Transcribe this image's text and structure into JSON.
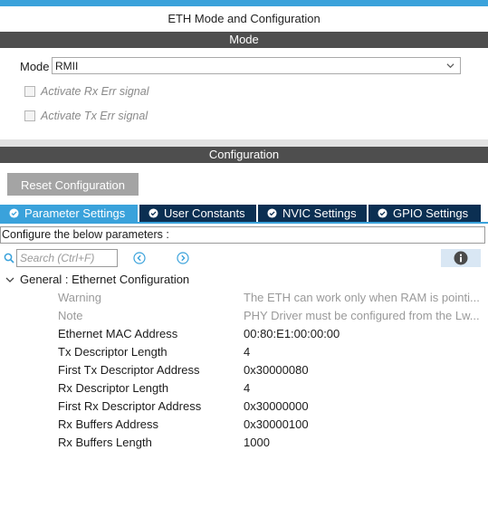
{
  "window": {
    "title": "ETH Mode and Configuration"
  },
  "mode_section": {
    "header": "Mode",
    "mode_label": "Mode",
    "mode_value": "RMII",
    "checkboxes": [
      {
        "label": "Activate Rx Err signal",
        "checked": false
      },
      {
        "label": "Activate Tx Err signal",
        "checked": false
      }
    ]
  },
  "config_section": {
    "header": "Configuration",
    "reset_label": "Reset Configuration",
    "tabs": [
      {
        "label": "Parameter Settings",
        "active": true
      },
      {
        "label": "User Constants",
        "active": false
      },
      {
        "label": "NVIC Settings",
        "active": false
      },
      {
        "label": "GPIO Settings",
        "active": false
      }
    ],
    "configure_text": "Configure the below parameters :",
    "search_placeholder": "Search (Ctrl+F)",
    "group_label": "General : Ethernet Configuration",
    "params": [
      {
        "name": "Warning",
        "value": "The ETH can work only when RAM is pointi...",
        "muted": true
      },
      {
        "name": "Note",
        "value": "PHY Driver must be configured from the Lw...",
        "muted": true
      },
      {
        "name": "Ethernet MAC Address",
        "value": "00:80:E1:00:00:00",
        "muted": false
      },
      {
        "name": "Tx Descriptor Length",
        "value": "4",
        "muted": false
      },
      {
        "name": "First Tx Descriptor Address",
        "value": "0x30000080",
        "muted": false
      },
      {
        "name": "Rx Descriptor Length",
        "value": "4",
        "muted": false
      },
      {
        "name": "First Rx Descriptor Address",
        "value": "0x30000000",
        "muted": false
      },
      {
        "name": "Rx Buffers Address",
        "value": "0x30000100",
        "muted": false
      },
      {
        "name": "Rx Buffers Length",
        "value": "1000",
        "muted": false
      }
    ]
  },
  "colors": {
    "accent": "#3aa2db",
    "tab_dark": "#0b2f52",
    "header_bg": "#4e4e4e",
    "button_gray": "#a4a4a4"
  },
  "icons": [
    "check-circle-icon",
    "search-icon",
    "previous-icon",
    "next-icon",
    "info-icon",
    "chevron-down-icon"
  ]
}
